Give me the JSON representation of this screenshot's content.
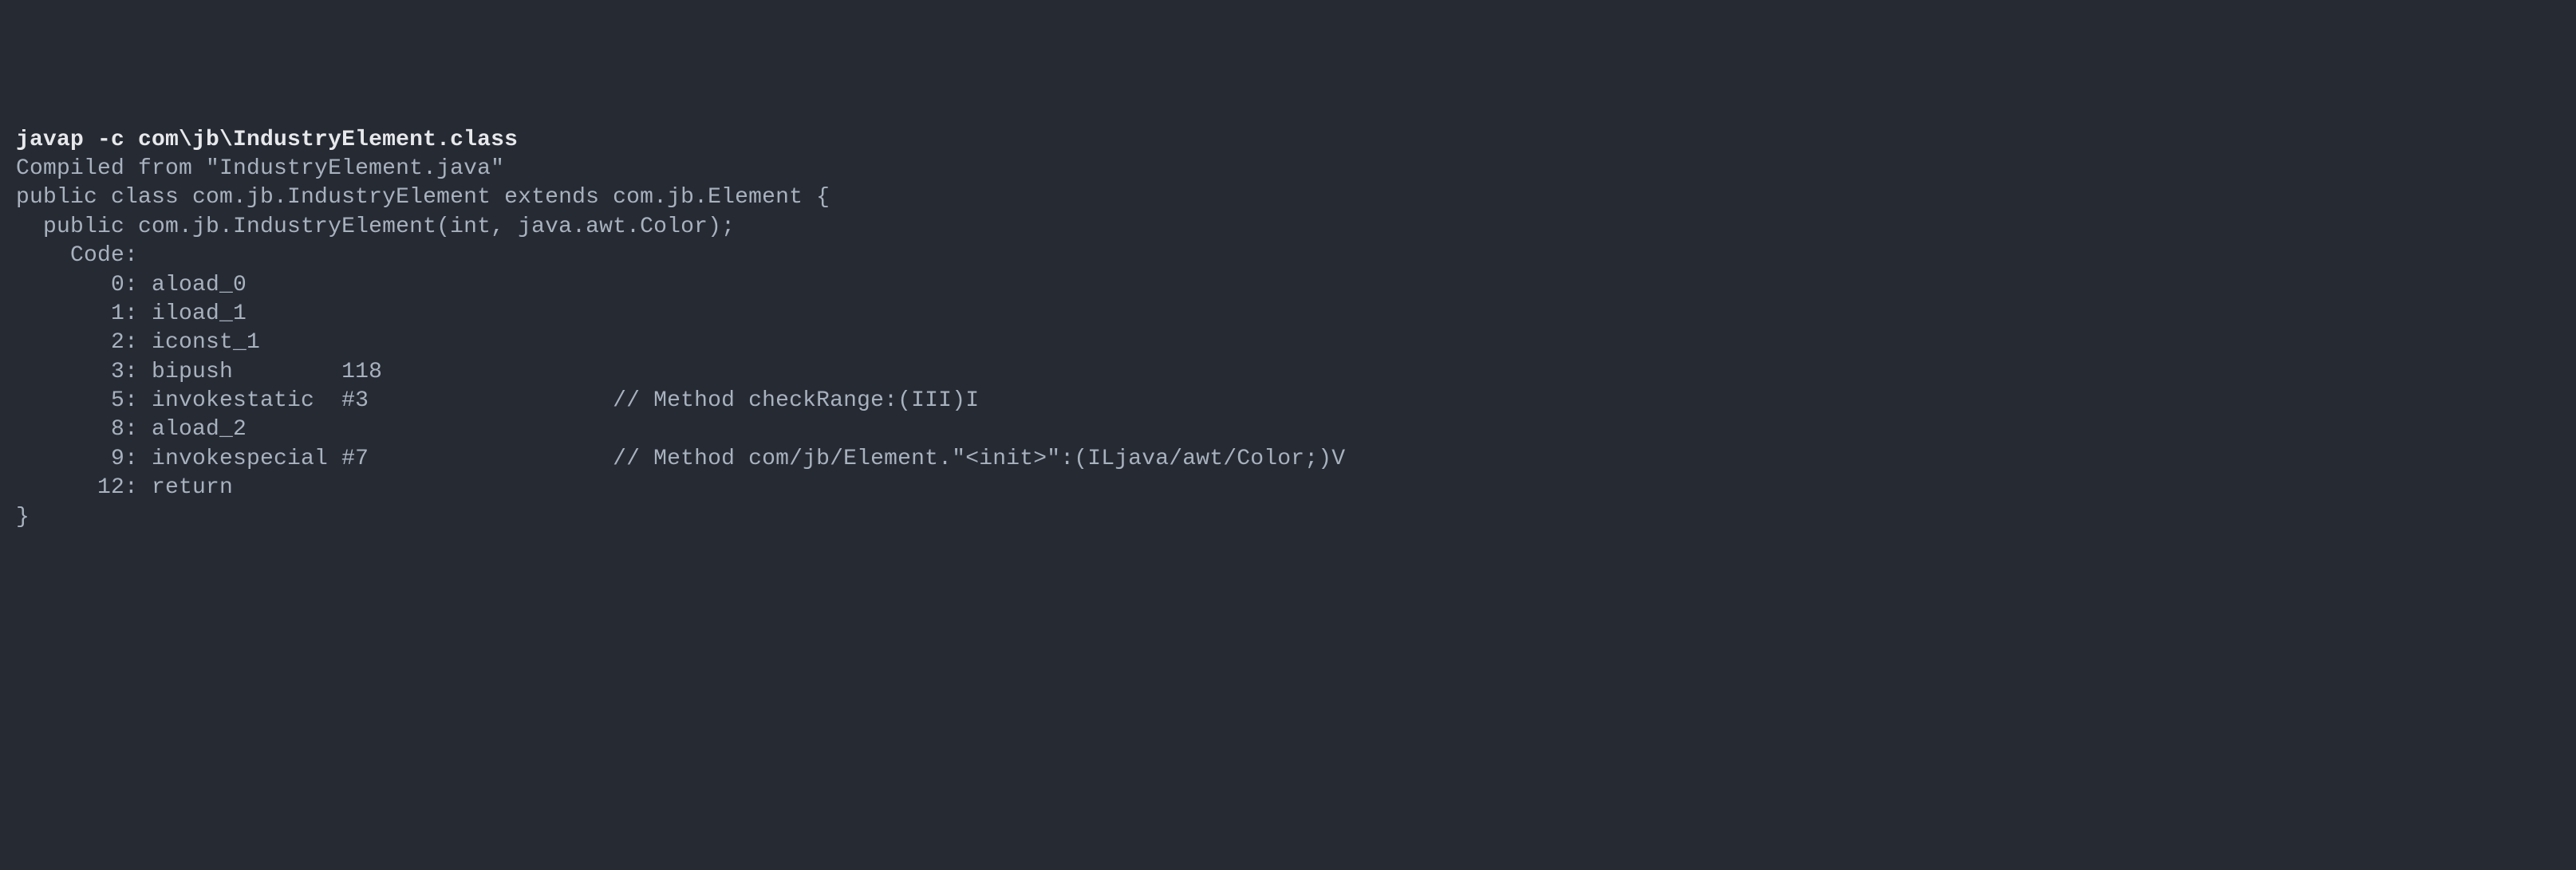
{
  "command": "javap -c com\\jb\\IndustryElement.class",
  "output_lines": [
    "Compiled from \"IndustryElement.java\"",
    "public class com.jb.IndustryElement extends com.jb.Element {",
    "  public com.jb.IndustryElement(int, java.awt.Color);",
    "    Code:",
    "       0: aload_0",
    "       1: iload_1",
    "       2: iconst_1",
    "       3: bipush        118",
    "       5: invokestatic  #3                  // Method checkRange:(III)I",
    "       8: aload_2",
    "       9: invokespecial #7                  // Method com/jb/Element.\"<init>\":(ILjava/awt/Color;)V",
    "      12: return",
    "}"
  ]
}
